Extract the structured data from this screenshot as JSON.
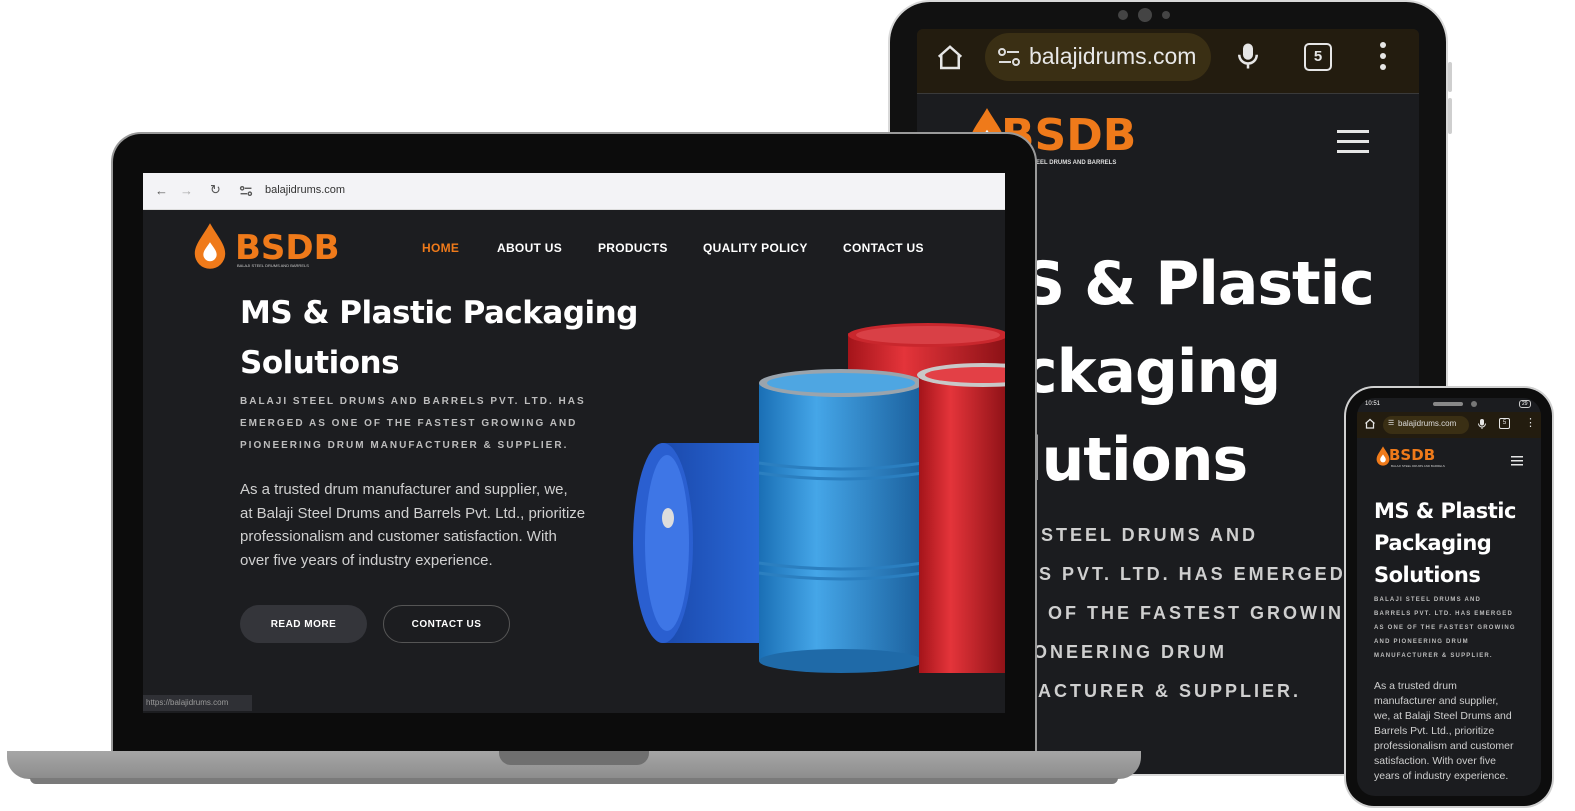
{
  "colors": {
    "accent": "#ef7a1a",
    "site_bg": "#1c1d20",
    "browser_dark": "#231c0f",
    "text_white": "#ffffff"
  },
  "laptop": {
    "browser": {
      "url": "balajidrums.com",
      "status_url": "https://balajidrums.com",
      "icons": [
        "back-arrow-icon",
        "forward-arrow-icon",
        "reload-icon",
        "site-settings-icon"
      ]
    },
    "logo": {
      "text": "BSDB",
      "tagline": "BALAJI STEEL DRUMS AND BARRELS"
    },
    "nav": [
      "HOME",
      "ABOUT US",
      "PRODUCTS",
      "QUALITY POLICY",
      "CONTACT US"
    ],
    "hero": {
      "title_line1": "MS & Plastic Packaging",
      "title_line2": "Solutions",
      "subtitle_lines": [
        "BALAJI STEEL DRUMS AND BARRELS PVT. LTD. HAS",
        "EMERGED AS ONE OF THE FASTEST GROWING AND",
        "PIONEERING DRUM MANUFACTURER & SUPPLIER."
      ],
      "para_lines": [
        "As a trusted drum manufacturer and supplier, we,",
        "at Balaji Steel Drums and Barrels Pvt. Ltd., prioritize",
        "professionalism and customer satisfaction. With",
        "over five years of industry experience."
      ],
      "read_more": "READ MORE",
      "contact_us": "CONTACT US"
    }
  },
  "tablet": {
    "browser": {
      "url": "balajidrums.com",
      "tab_count": "5"
    },
    "logo": {
      "text": "BSDB",
      "tagline": "BALAJI STEEL DRUMS AND BARRELS"
    },
    "hero_lines": [
      "S & Plastic",
      "ckaging",
      "lutions"
    ],
    "sub_lines": [
      "I STEEL DRUMS AND",
      "LS PVT. LTD. HAS EMERGED",
      "E OF THE FASTEST GROWING",
      "IONEERING DRUM",
      "FACTURER & SUPPLIER."
    ]
  },
  "phone": {
    "status": {
      "time": "10:51",
      "battery": "29"
    },
    "browser": {
      "url": "balajidrums.com",
      "tab_count": "5"
    },
    "logo": {
      "text": "BSDB",
      "tagline": "BALAJI STEEL DRUMS AND BARRELS"
    },
    "title_lines": [
      "MS & Plastic",
      "Packaging",
      "Solutions"
    ],
    "sub_lines": [
      "BALAJI STEEL DRUMS AND",
      "BARRELS PVT. LTD. HAS EMERGED",
      "AS ONE OF THE FASTEST GROWING",
      "AND PIONEERING DRUM",
      "MANUFACTURER & SUPPLIER."
    ],
    "para_lines": [
      "As a trusted drum",
      "manufacturer and supplier,",
      "we, at Balaji Steel Drums and",
      "Barrels Pvt. Ltd., prioritize",
      "professionalism and customer",
      "satisfaction. With over five",
      "years of industry experience."
    ]
  }
}
